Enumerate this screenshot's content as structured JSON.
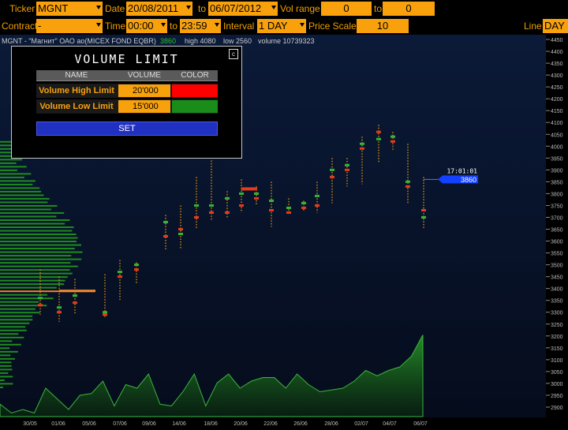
{
  "toolbar_row1": {
    "ticker_label": "Ticker",
    "ticker_value": "MGNT",
    "date_label": "Date",
    "date_from": "20/08/2011",
    "date_to_label": "to",
    "date_to": "06/07/2012",
    "vol_range_label": "Vol range",
    "vol_from": "0",
    "vol_to_label": "to",
    "vol_to": "0"
  },
  "toolbar_row2": {
    "contract_label": "Contract",
    "contract_value": "-",
    "time_label": "Time",
    "time_from": "00:00",
    "time_to_label": "to",
    "time_to": "23:59",
    "interval_label": "Interval",
    "interval_value": "1 DAY",
    "price_scale_label": "Price Scale",
    "price_scale_value": "10",
    "line_label": "Line",
    "line_value": "DAY"
  },
  "chart_info": {
    "instrument": "MGNT - \"Магнит\" ОАО ао(MICEX FOND EQBR)",
    "last": "3860",
    "high": "high 4080",
    "low": "low 2560",
    "volume": "volume 10739323"
  },
  "chart_data": {
    "type": "candlestick",
    "x_tick_labels": [
      "30/05",
      "01/06",
      "05/06",
      "07/06",
      "09/06",
      "14/06",
      "18/06",
      "20/06",
      "22/06",
      "26/06",
      "28/06",
      "02/07",
      "04/07",
      "06/07"
    ],
    "y_ticks": [
      2900,
      2950,
      3000,
      3050,
      3100,
      3150,
      3200,
      3250,
      3300,
      3350,
      3400,
      3450,
      3500,
      3550,
      3600,
      3650,
      3700,
      3750,
      3800,
      3850,
      3900,
      3950,
      4000,
      4050,
      4100,
      4150,
      4200,
      4250,
      4300,
      4350,
      4400,
      4450
    ],
    "ylim": [
      2880,
      4470
    ],
    "candles": [
      {
        "x": 51,
        "low": 3290,
        "high": 3480,
        "open": 3330,
        "close": 3360
      },
      {
        "x": 75,
        "low": 3260,
        "high": 3450,
        "open": 3300,
        "close": 3320
      },
      {
        "x": 95,
        "low": 3290,
        "high": 3440,
        "open": 3340,
        "close": 3370
      },
      {
        "x": 133,
        "low": 3280,
        "high": 3460,
        "open": 3290,
        "close": 3300
      },
      {
        "x": 152,
        "low": 3350,
        "high": 3520,
        "open": 3450,
        "close": 3470
      },
      {
        "x": 173,
        "low": 3420,
        "high": 3510,
        "open": 3480,
        "close": 3500
      },
      {
        "x": 210,
        "low": 3560,
        "high": 3710,
        "open": 3620,
        "close": 3680
      },
      {
        "x": 229,
        "low": 3570,
        "high": 3750,
        "open": 3650,
        "close": 3630
      },
      {
        "x": 249,
        "low": 3650,
        "high": 3870,
        "open": 3700,
        "close": 3750
      },
      {
        "x": 268,
        "low": 3690,
        "high": 3940,
        "open": 3720,
        "close": 3750
      },
      {
        "x": 288,
        "low": 3700,
        "high": 3810,
        "open": 3720,
        "close": 3780
      },
      {
        "x": 306,
        "low": 3720,
        "high": 3860,
        "open": 3750,
        "close": 3800
      },
      {
        "x": 325,
        "low": 3750,
        "high": 3830,
        "open": 3780,
        "close": 3800
      },
      {
        "x": 344,
        "low": 3660,
        "high": 3850,
        "open": 3730,
        "close": 3770
      },
      {
        "x": 366,
        "low": 3710,
        "high": 3780,
        "open": 3720,
        "close": 3740
      },
      {
        "x": 385,
        "low": 3730,
        "high": 3770,
        "open": 3740,
        "close": 3760
      },
      {
        "x": 402,
        "low": 3720,
        "high": 3850,
        "open": 3750,
        "close": 3790
      },
      {
        "x": 421,
        "low": 3760,
        "high": 3950,
        "open": 3870,
        "close": 3900
      },
      {
        "x": 440,
        "low": 3830,
        "high": 3950,
        "open": 3900,
        "close": 3920
      },
      {
        "x": 459,
        "low": 3840,
        "high": 4040,
        "open": 3990,
        "close": 4010
      },
      {
        "x": 480,
        "low": 3930,
        "high": 4090,
        "open": 4060,
        "close": 4030
      },
      {
        "x": 498,
        "low": 3980,
        "high": 4060,
        "open": 4020,
        "close": 4040
      },
      {
        "x": 517,
        "low": 3760,
        "high": 4010,
        "open": 3830,
        "close": 3850
      },
      {
        "x": 537,
        "low": 3650,
        "high": 3870,
        "open": 3730,
        "close": 3700
      }
    ],
    "volume_series": [
      35,
      10,
      20,
      10,
      80,
      50,
      20,
      60,
      65,
      100,
      30,
      90,
      80,
      120,
      35,
      30,
      70,
      120,
      30,
      95,
      120,
      80,
      100,
      110,
      110,
      80,
      120,
      90,
      70,
      75,
      80,
      100,
      130,
      115,
      130,
      140,
      170,
      230
    ],
    "current_price": {
      "time": "17:01:01",
      "price": "3860",
      "level": 3860
    }
  },
  "dialog": {
    "title": "VOLUME LIMIT",
    "close_symbol": "c",
    "col_name": "NAME",
    "col_volume": "VOLUME",
    "col_color": "COLOR",
    "rows": [
      {
        "name": "Volume High Limit",
        "volume": "20'000",
        "color": "#ff0000"
      },
      {
        "name": "Volume Low Limit",
        "volume": "15'000",
        "color": "#1a8c1a"
      }
    ],
    "set_label": "SET"
  },
  "colors": {
    "accent": "#f8a10c",
    "bg_top": "#0a1833",
    "bg_bottom": "#050d1e",
    "profile": "#1e8c1e",
    "profile_high": "#ff7a30",
    "set_button": "#2030c0"
  }
}
